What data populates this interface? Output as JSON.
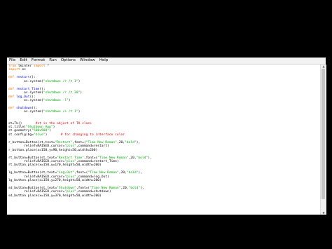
{
  "menu": [
    "File",
    "Edit",
    "Format",
    "Run",
    "Options",
    "Window",
    "Help"
  ],
  "code_lines": [
    [
      {
        "t": "from",
        "c": "kw"
      },
      {
        "t": " tkinter "
      },
      {
        "t": "import",
        "c": "kw"
      },
      {
        "t": " *"
      }
    ],
    [
      {
        "t": "import",
        "c": "kw"
      },
      {
        "t": " os"
      }
    ],
    [],
    [
      {
        "t": "def",
        "c": "kw"
      },
      {
        "t": " "
      },
      {
        "t": "restart",
        "c": "fn"
      },
      {
        "t": "():"
      }
    ],
    [
      {
        "t": "        os.system("
      },
      {
        "t": "\"shutdown /r /t 1\"",
        "c": "str"
      },
      {
        "t": ")"
      }
    ],
    [],
    [
      {
        "t": "def",
        "c": "kw"
      },
      {
        "t": " "
      },
      {
        "t": "restart_Time",
        "c": "fn"
      },
      {
        "t": "():"
      }
    ],
    [
      {
        "t": "        os.system("
      },
      {
        "t": "\"shutdown /r /t 20\"",
        "c": "str"
      },
      {
        "t": ")"
      }
    ],
    [
      {
        "t": "def",
        "c": "kw"
      },
      {
        "t": " "
      },
      {
        "t": "log_Out",
        "c": "fn"
      },
      {
        "t": "():"
      }
    ],
    [
      {
        "t": "        os.system("
      },
      {
        "t": "\"shutdown -l\"",
        "c": "str"
      },
      {
        "t": ")"
      }
    ],
    [],
    [
      {
        "t": "def",
        "c": "kw"
      },
      {
        "t": " "
      },
      {
        "t": "shutdown",
        "c": "fn"
      },
      {
        "t": "():"
      }
    ],
    [
      {
        "t": "        os.system("
      },
      {
        "t": "\"shutdown /s /t 1\"",
        "c": "str"
      },
      {
        "t": ")"
      }
    ],
    [],
    [],
    [
      {
        "t": "st=Tk()       "
      },
      {
        "t": "#st is the object of TK class",
        "c": "cm"
      }
    ],
    [
      {
        "t": "st.title("
      },
      {
        "t": "\"Shutdown App\"",
        "c": "str"
      },
      {
        "t": ")"
      }
    ],
    [
      {
        "t": "st.geometry("
      },
      {
        "t": "\"500x500\"",
        "c": "str"
      },
      {
        "t": ")"
      }
    ],
    [
      {
        "t": "st.config(bg="
      },
      {
        "t": "\"blue\"",
        "c": "str"
      },
      {
        "t": ")       "
      },
      {
        "t": "# for changing to interface color",
        "c": "cm"
      }
    ],
    [],
    [
      {
        "t": "r_button=Button(st,text="
      },
      {
        "t": "\"Restart\"",
        "c": "str"
      },
      {
        "t": ",font=("
      },
      {
        "t": "\"Time New Roman\"",
        "c": "str"
      },
      {
        "t": ",20,"
      },
      {
        "t": "\"bold\"",
        "c": "str"
      },
      {
        "t": "),"
      }
    ],
    [
      {
        "t": "        relief=RAISED,cursor="
      },
      {
        "t": "\"plus\"",
        "c": "str"
      },
      {
        "t": ",command=restart)"
      }
    ],
    [
      {
        "t": "r_button.place(x=150,y=90,height=50,width=200)"
      }
    ],
    [],
    [
      {
        "t": "rt_button=Button(st,text="
      },
      {
        "t": "\"Restart Time\"",
        "c": "str"
      },
      {
        "t": ",font=("
      },
      {
        "t": "\"Time New Roman\"",
        "c": "str"
      },
      {
        "t": ",20,"
      },
      {
        "t": "\"bold\"",
        "c": "str"
      },
      {
        "t": "),"
      }
    ],
    [
      {
        "t": "        relief=RAISED,cursor="
      },
      {
        "t": "\"plus\"",
        "c": "str"
      },
      {
        "t": ",command=restart_Time)"
      }
    ],
    [
      {
        "t": "rt_button.place(x=150,y=170,height=50,width=200)"
      }
    ],
    [],
    [
      {
        "t": "lg_button=Button(st,text="
      },
      {
        "t": "\"Log-Out\"",
        "c": "str"
      },
      {
        "t": ",font=("
      },
      {
        "t": "\"Time New Roman\"",
        "c": "str"
      },
      {
        "t": ",20,"
      },
      {
        "t": "\"bold\"",
        "c": "str"
      },
      {
        "t": "),"
      }
    ],
    [
      {
        "t": "        relief=RAISED,cursor="
      },
      {
        "t": "\"plus\"",
        "c": "str"
      },
      {
        "t": ",command=log_Out)"
      }
    ],
    [
      {
        "t": "lg_button.place(x=150,y=270,height=50,width=200)"
      }
    ],
    [],
    [
      {
        "t": "sd_button=Button(st,text="
      },
      {
        "t": "\"Shutdown\"",
        "c": "str"
      },
      {
        "t": ",font=("
      },
      {
        "t": "\"Time New Roman\"",
        "c": "str"
      },
      {
        "t": ",20,"
      },
      {
        "t": "\"bold\"",
        "c": "str"
      },
      {
        "t": "),"
      }
    ],
    [
      {
        "t": "        relief=RAISED,cursor="
      },
      {
        "t": "\"plus\"",
        "c": "str"
      },
      {
        "t": ",command=shutdown)"
      }
    ],
    [
      {
        "t": "sd_button.place(x=150,y=370,height=50,width=200)"
      }
    ]
  ],
  "colors": {
    "keyword": "#ff7700",
    "function_name": "#0000ff",
    "string": "#00aa00",
    "comment": "#dd0000",
    "background": "#ffffff",
    "desktop": "#000000"
  },
  "icons": {
    "scroll_up": "up-arrow-icon",
    "scroll_down": "down-arrow-icon"
  }
}
